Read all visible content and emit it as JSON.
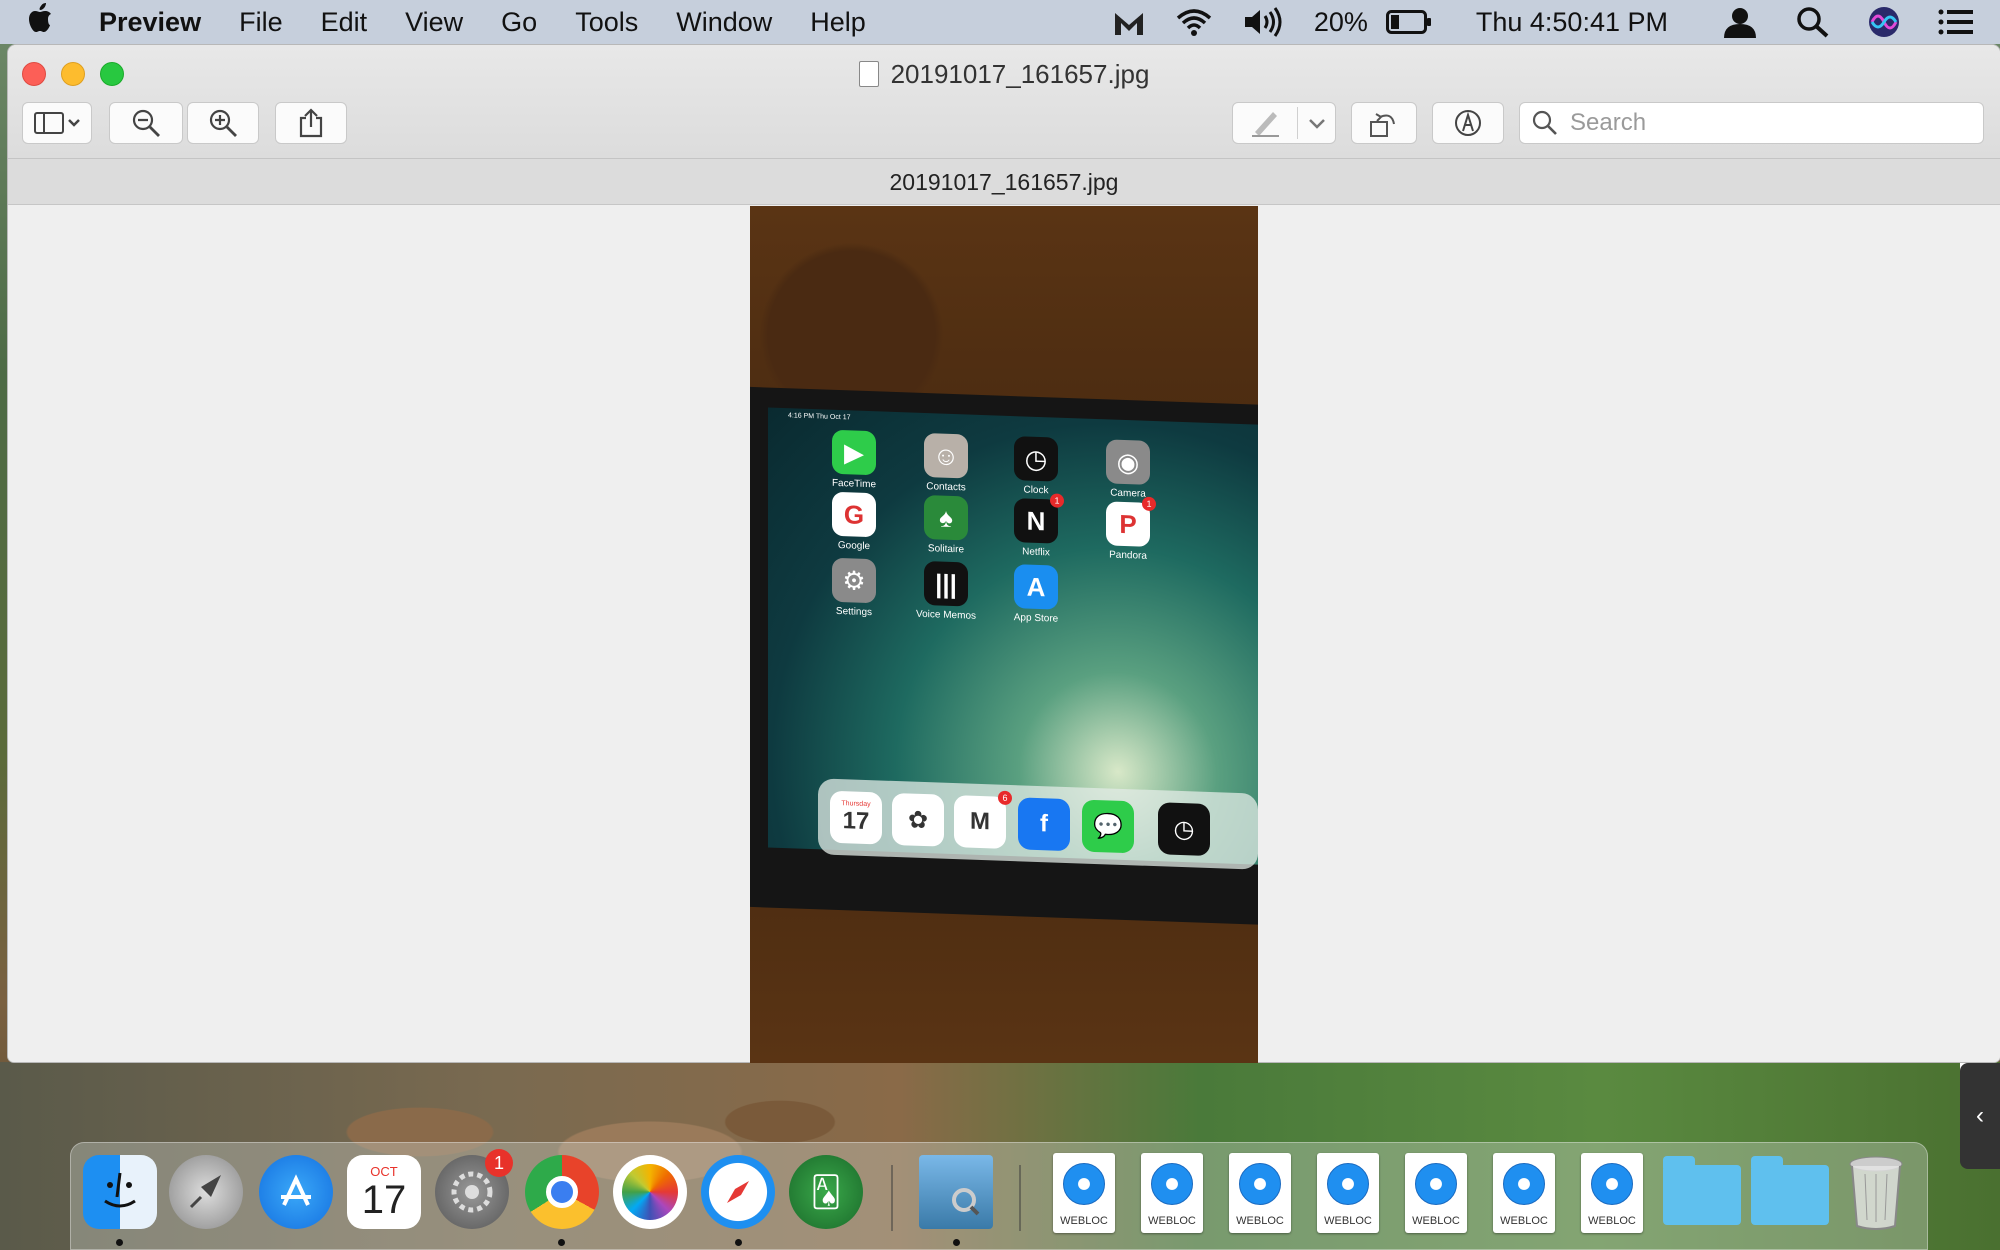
{
  "menubar": {
    "app_name": "Preview",
    "menus": [
      "File",
      "Edit",
      "View",
      "Go",
      "Tools",
      "Window",
      "Help"
    ],
    "battery": "20%",
    "clock": "Thu 4:50:41 PM"
  },
  "window": {
    "title": "20191017_161657.jpg",
    "doc_header": "20191017_161657.jpg",
    "search_placeholder": "Search"
  },
  "photo": {
    "status_text": "4:16 PM Thu Oct 17",
    "apps": [
      {
        "label": "FaceTime",
        "color": "#2ecc4a",
        "glyph": "▶"
      },
      {
        "label": "Contacts",
        "color": "#b8b0a8",
        "glyph": "☺"
      },
      {
        "label": "Clock",
        "color": "#111111",
        "glyph": "◷"
      },
      {
        "label": "Camera",
        "color": "#8a8a8a",
        "glyph": "◉"
      },
      {
        "label": "Google",
        "color": "#ffffff",
        "glyph": "G"
      },
      {
        "label": "Solitaire",
        "color": "#2a8a3a",
        "glyph": "♠"
      },
      {
        "label": "Netflix",
        "color": "#111111",
        "glyph": "N",
        "badge": "1"
      },
      {
        "label": "Pandora",
        "color": "#ffffff",
        "glyph": "P",
        "badge": "1"
      },
      {
        "label": "Settings",
        "color": "#8a8a8a",
        "glyph": "⚙"
      },
      {
        "label": "Voice Memos",
        "color": "#111111",
        "glyph": "|||"
      },
      {
        "label": "App Store",
        "color": "#1a8ef0",
        "glyph": "A"
      }
    ],
    "dock_apps": [
      {
        "name": "Calendar",
        "color": "#ffffff",
        "glyph": "17",
        "caption": "Thursday"
      },
      {
        "name": "Photos",
        "color": "#ffffff",
        "glyph": "✿"
      },
      {
        "name": "Gmail",
        "color": "#ffffff",
        "glyph": "M",
        "badge": "6"
      },
      {
        "name": "Facebook",
        "color": "#1877f2",
        "glyph": "f"
      },
      {
        "name": "Messages",
        "color": "#2ecc4a",
        "glyph": "💬"
      },
      {
        "name": "Clock",
        "color": "#111111",
        "glyph": "◷"
      }
    ]
  },
  "dock": {
    "calendar_month": "OCT",
    "calendar_day": "17",
    "system_prefs_badge": "1",
    "webloc_label": "WEBLOC",
    "webloc_count": 7
  }
}
